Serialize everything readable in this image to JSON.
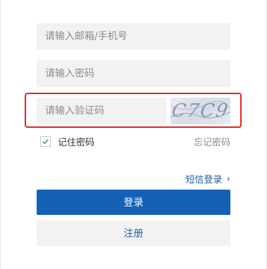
{
  "form": {
    "email_placeholder": "请输入邮箱/手机号",
    "password_placeholder": "请输入密码",
    "captcha_placeholder": "请输入验证码",
    "captcha_text": "C7C9",
    "remember_label": "记住密码",
    "remember_checked": true,
    "forgot_label": "忘记密码",
    "sms_login_label": "短信登录",
    "sms_chevron": "›",
    "login_button": "登录",
    "register_button": "注册"
  },
  "colors": {
    "highlight": "#e0251f",
    "primary": "#1362b5",
    "link": "#1a5fa8"
  }
}
